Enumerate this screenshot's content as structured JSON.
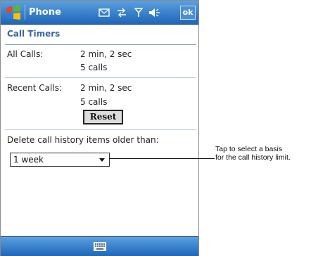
{
  "title_bar": {
    "app_title": "Phone",
    "ok_label": "ok",
    "icons": [
      "windows-start-icon",
      "sms-icon",
      "connectivity-icon",
      "signal-icon",
      "volume-icon"
    ]
  },
  "page": {
    "heading": "Call Timers"
  },
  "all_calls": {
    "label": "All Calls:",
    "duration": "2 min, 2 sec",
    "count": "5 calls"
  },
  "recent_calls": {
    "label": "Recent Calls:",
    "duration": "2 min, 2 sec",
    "count": "5 calls",
    "reset_label": "Reset"
  },
  "history": {
    "label": "Delete call history items older than:",
    "selected_value": "1 week"
  },
  "menu_bar": {
    "icons": [
      "keyboard-icon"
    ]
  },
  "callout": {
    "line1": "Tap to select a basis",
    "line2": "for the call history limit."
  },
  "colors": {
    "title_bar": "#2a74c6",
    "heading": "#3b66a8",
    "separator": "#b8c8df"
  }
}
